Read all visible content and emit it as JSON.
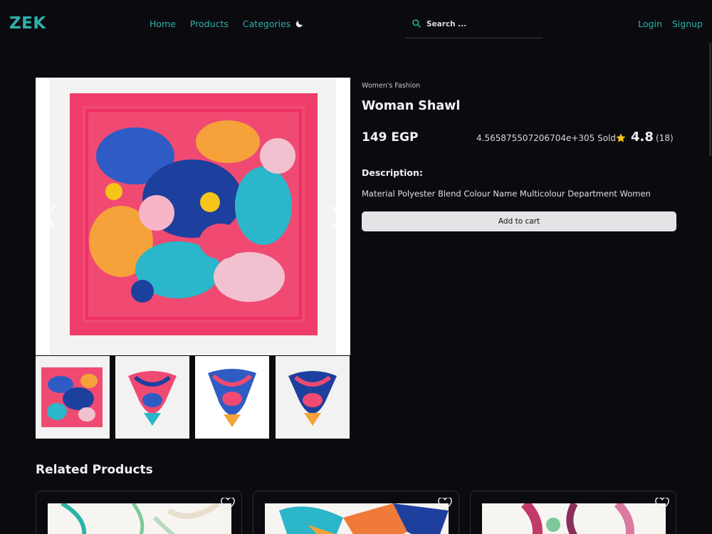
{
  "nav": {
    "logo": "ZEK",
    "links": [
      "Home",
      "Products",
      "Categories"
    ],
    "search_placeholder": "Search ...",
    "auth": [
      "Login",
      "Signup"
    ],
    "accent_color": "#2bb3a8"
  },
  "product": {
    "category": "Women's Fashion",
    "title": "Woman Shawl",
    "price": "149 EGP",
    "sold": "4.565875507206704e+305 Sold",
    "rating": "4.8",
    "reviews": "(18)",
    "description_label": "Description:",
    "description": "Material Polyester Blend Colour Name Multicolour Department Women",
    "add_to_cart_label": "Add to cart"
  },
  "gallery": {
    "thumbnail_count": 4
  },
  "related": {
    "title": "Related Products",
    "cards": [
      {
        "icon": "heart-icon"
      },
      {
        "icon": "heart-icon"
      },
      {
        "icon": "heart-icon"
      }
    ]
  },
  "colors": {
    "background": "#0b0a0f",
    "star": "#f5c518",
    "button": "#e4e4e7"
  }
}
